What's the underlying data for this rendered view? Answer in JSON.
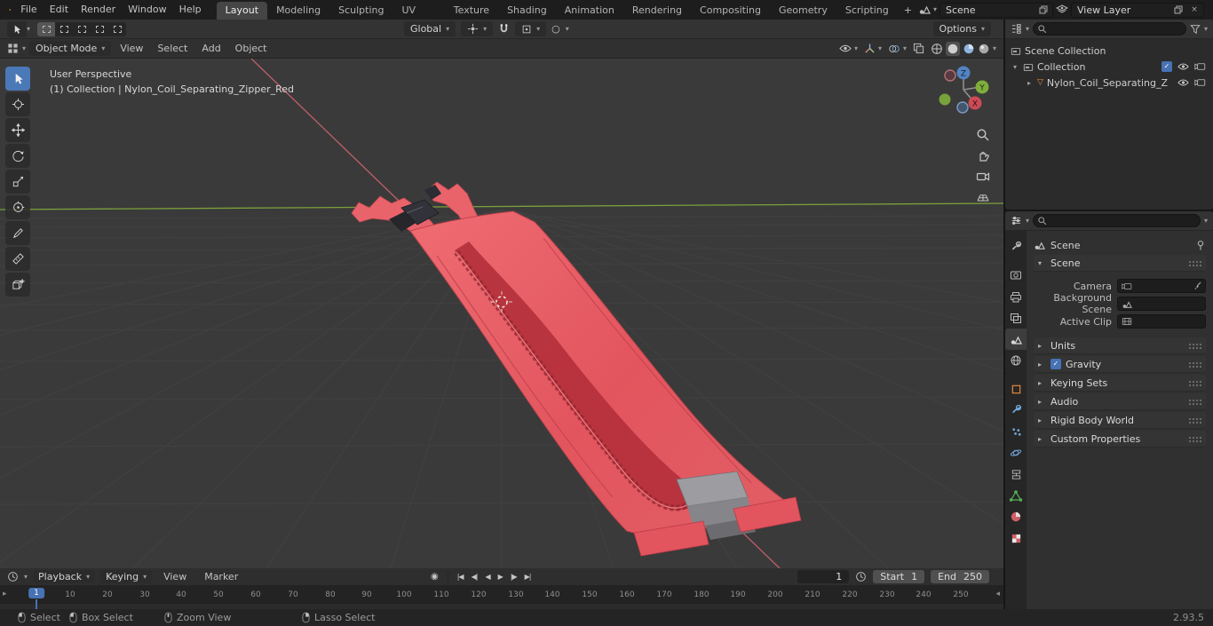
{
  "icons": {
    "dropdown": "▾",
    "expanded": "▾",
    "collapsed": "▸",
    "back_arrow": "◂",
    "fwd_arrow": "▸",
    "check": "✓",
    "close": "×",
    "add": "+",
    "autokey": "◉",
    "jump_start": "|◀",
    "prev_key": "◀|",
    "play_rev": "◀",
    "play": "▶",
    "next_key": "|▶",
    "jump_end": "▶|",
    "prop_circle": "○",
    "mesh": "▽"
  },
  "topbar": {
    "menus": [
      "File",
      "Edit",
      "Render",
      "Window",
      "Help"
    ],
    "workspaces": [
      "Layout",
      "Modeling",
      "Sculpting",
      "UV Editing",
      "Texture Paint",
      "Shading",
      "Animation",
      "Rendering",
      "Compositing",
      "Geometry Nodes",
      "Scripting"
    ],
    "active_workspace": "Layout",
    "scene_value": "Scene",
    "view_layer_value": "View Layer"
  },
  "tool_settings": {
    "orientation": "Global",
    "options_label": "Options"
  },
  "viewport_header": {
    "mode": "Object Mode",
    "menus": [
      "View",
      "Select",
      "Add",
      "Object"
    ]
  },
  "viewport": {
    "view_label": "User Perspective",
    "context_label": "(1) Collection | Nylon_Coil_Separating_Zipper_Red",
    "axis_x": "X",
    "axis_y": "Y",
    "axis_z": "Z"
  },
  "outliner": {
    "scene_collection": "Scene Collection",
    "collection": "Collection",
    "object_name": "Nylon_Coil_Separating_Z"
  },
  "properties": {
    "breadcrumb": "Scene",
    "panel_scene": "Scene",
    "field_camera": "Camera",
    "field_background_scene": "Background Scene",
    "field_active_clip": "Active Clip",
    "panel_units": "Units",
    "panel_gravity": "Gravity",
    "panel_keying_sets": "Keying Sets",
    "panel_audio": "Audio",
    "panel_rigid_body": "Rigid Body World",
    "panel_custom_props": "Custom Properties",
    "gravity_checked": true
  },
  "timeline": {
    "menus": [
      "Playback",
      "Keying",
      "View",
      "Marker"
    ],
    "current_frame": "1",
    "start_label": "Start",
    "start_value": "1",
    "end_label": "End",
    "end_value": "250",
    "playhead": "1",
    "ticks": [
      "10",
      "20",
      "30",
      "40",
      "50",
      "60",
      "70",
      "80",
      "90",
      "100",
      "110",
      "120",
      "130",
      "140",
      "150",
      "160",
      "170",
      "180",
      "190",
      "200",
      "210",
      "220",
      "230",
      "240",
      "250"
    ]
  },
  "statusbar": {
    "hint_select": "Select",
    "hint_box": "Box Select",
    "hint_zoom": "Zoom View",
    "hint_lasso": "Lasso Select",
    "version": "2.93.5"
  }
}
